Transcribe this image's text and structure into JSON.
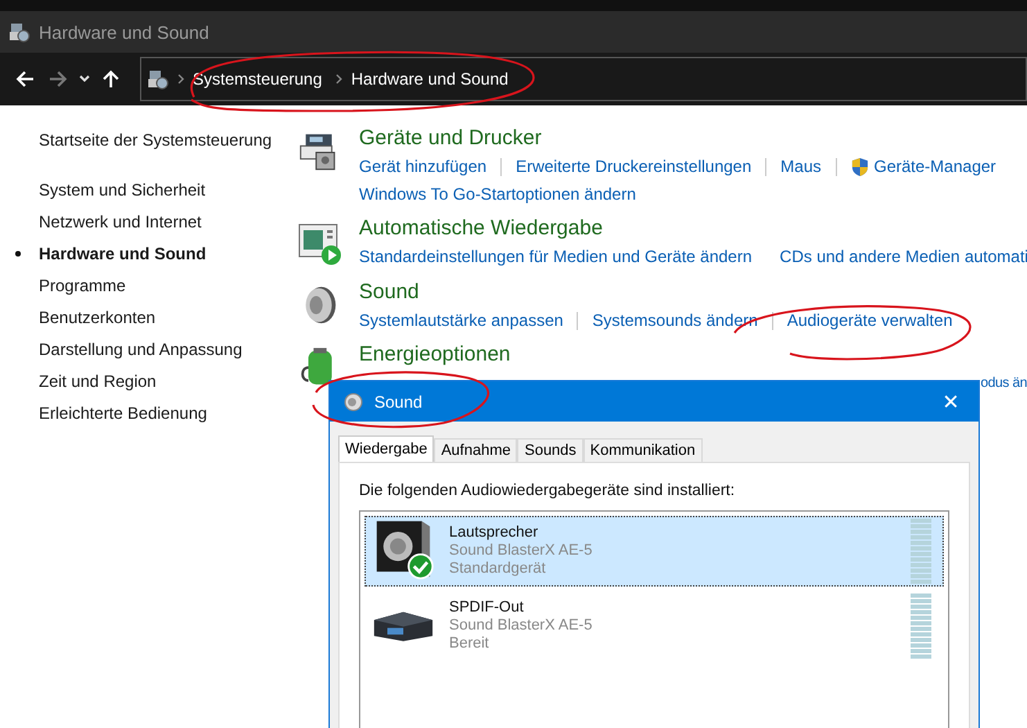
{
  "window": {
    "title": "Hardware und Sound"
  },
  "address_bar": {
    "breadcrumbs": [
      "Systemsteuerung",
      "Hardware und Sound"
    ]
  },
  "sidebar": {
    "home": "Startseite der Systemsteuerung",
    "items": [
      {
        "label": "System und Sicherheit",
        "selected": false
      },
      {
        "label": "Netzwerk und Internet",
        "selected": false
      },
      {
        "label": "Hardware und Sound",
        "selected": true
      },
      {
        "label": "Programme",
        "selected": false
      },
      {
        "label": "Benutzerkonten",
        "selected": false
      },
      {
        "label": "Darstellung und Anpassung",
        "selected": false
      },
      {
        "label": "Zeit und Region",
        "selected": false
      },
      {
        "label": "Erleichterte Bedienung",
        "selected": false
      }
    ]
  },
  "categories": [
    {
      "kind": "devices",
      "title": "Geräte und Drucker",
      "links": [
        [
          {
            "text": "Gerät hinzufügen"
          },
          {
            "text": "Erweiterte Druckereinstellungen"
          },
          {
            "text": "Maus"
          },
          {
            "text": "Geräte-Manager",
            "shield": true
          }
        ],
        [
          {
            "text": "Windows To Go-Startoptionen ändern"
          }
        ]
      ]
    },
    {
      "kind": "autoplay",
      "title": "Automatische Wiedergabe",
      "links": [
        [
          {
            "text": "Standardeinstellungen für Medien und Geräte ändern"
          },
          {
            "text": "CDs und andere Medien automati"
          }
        ]
      ]
    },
    {
      "kind": "sound",
      "title": "Sound",
      "links": [
        [
          {
            "text": "Systemlautstärke anpassen"
          },
          {
            "text": "Systemsounds ändern"
          },
          {
            "text": "Audiogeräte verwalten"
          }
        ]
      ]
    },
    {
      "kind": "power",
      "title": "Energieoptionen",
      "links": [
        [
          {
            "text": "odus än",
            "trailing": true
          }
        ]
      ]
    }
  ],
  "dialog": {
    "title": "Sound",
    "close": "✕",
    "tabs": [
      {
        "label": "Wiedergabe",
        "selected": true
      },
      {
        "label": "Aufnahme",
        "selected": false
      },
      {
        "label": "Sounds",
        "selected": false
      },
      {
        "label": "Kommunikation",
        "selected": false
      }
    ],
    "intro": "Die folgenden Audiowiedergabegeräte sind installiert:",
    "devices": [
      {
        "kind": "speaker",
        "name": "Lautsprecher",
        "driver": "Sound BlasterX AE-5",
        "status": "Standardgerät",
        "selected": true,
        "default": true
      },
      {
        "kind": "spdif",
        "name": "SPDIF-Out",
        "driver": "Sound BlasterX AE-5",
        "status": "Bereit",
        "selected": false,
        "default": false
      }
    ]
  }
}
